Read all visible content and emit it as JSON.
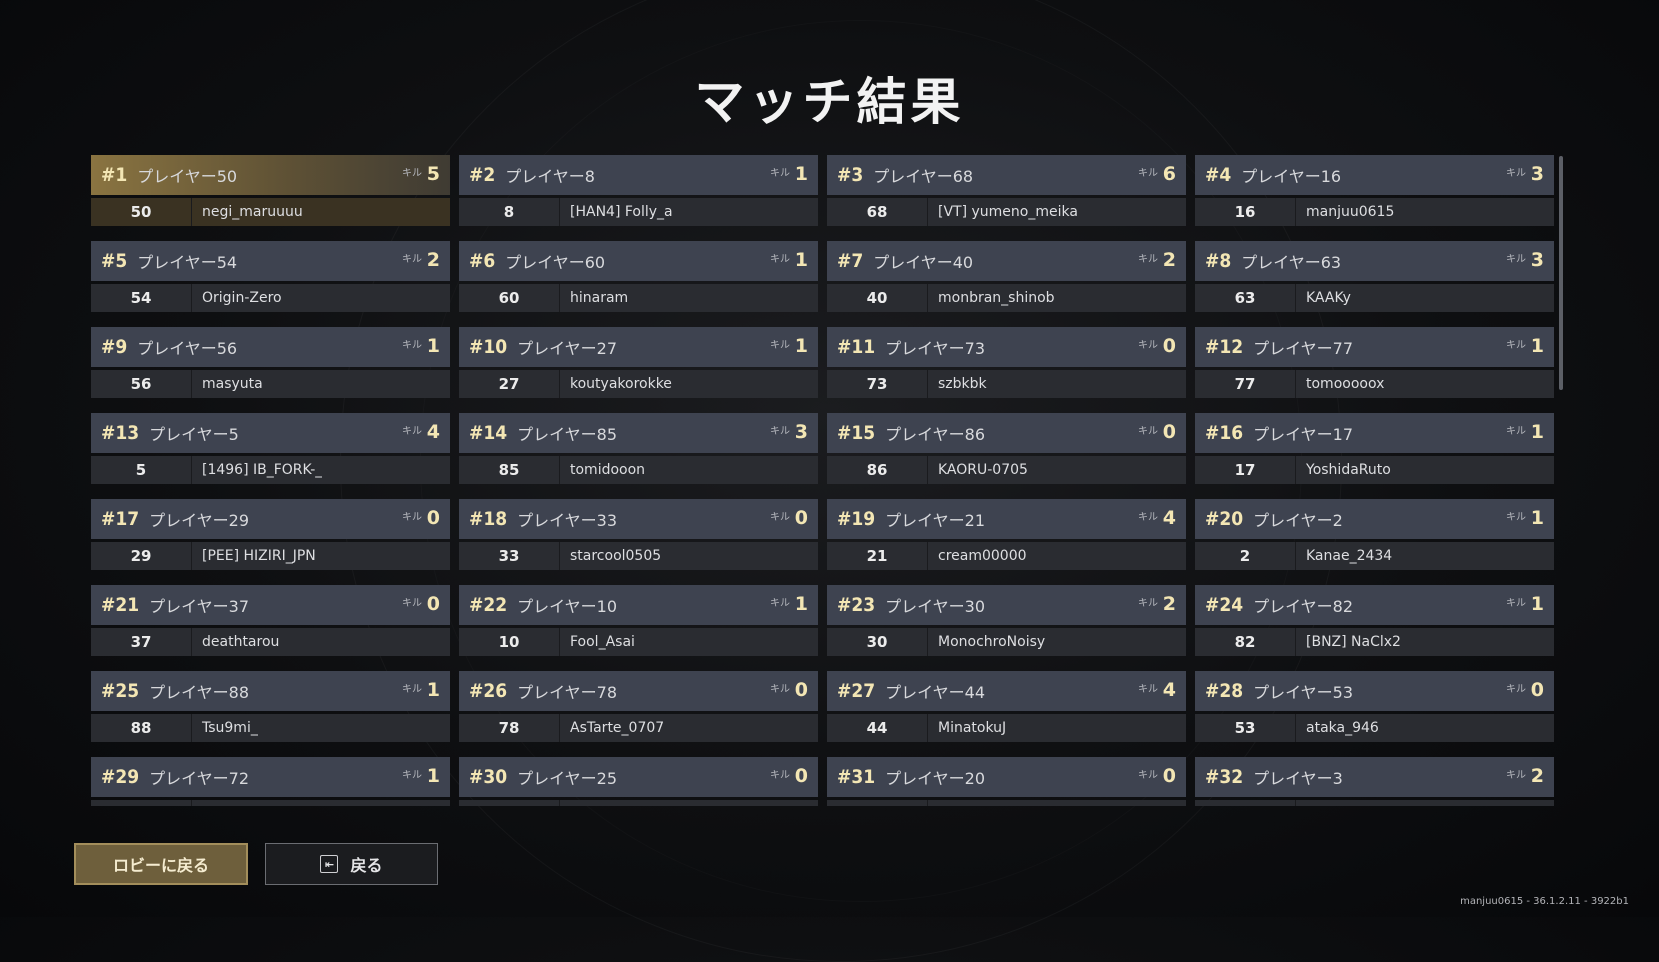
{
  "title": "マッチ結果",
  "kill_label": "キル",
  "results": [
    {
      "rank": "#1",
      "player": "プレイヤー50",
      "kills": "5",
      "num": "50",
      "user": "negi_maruuuu"
    },
    {
      "rank": "#2",
      "player": "プレイヤー8",
      "kills": "1",
      "num": "8",
      "user": "[HAN4] Folly_a"
    },
    {
      "rank": "#3",
      "player": "プレイヤー68",
      "kills": "6",
      "num": "68",
      "user": "[VT] yumeno_meika"
    },
    {
      "rank": "#4",
      "player": "プレイヤー16",
      "kills": "3",
      "num": "16",
      "user": "manjuu0615"
    },
    {
      "rank": "#5",
      "player": "プレイヤー54",
      "kills": "2",
      "num": "54",
      "user": "Origin-Zero"
    },
    {
      "rank": "#6",
      "player": "プレイヤー60",
      "kills": "1",
      "num": "60",
      "user": "hinaram"
    },
    {
      "rank": "#7",
      "player": "プレイヤー40",
      "kills": "2",
      "num": "40",
      "user": "monbran_shinob"
    },
    {
      "rank": "#8",
      "player": "プレイヤー63",
      "kills": "3",
      "num": "63",
      "user": "KAAKy"
    },
    {
      "rank": "#9",
      "player": "プレイヤー56",
      "kills": "1",
      "num": "56",
      "user": "masyuta"
    },
    {
      "rank": "#10",
      "player": "プレイヤー27",
      "kills": "1",
      "num": "27",
      "user": "koutyakorokke"
    },
    {
      "rank": "#11",
      "player": "プレイヤー73",
      "kills": "0",
      "num": "73",
      "user": "szbkbk"
    },
    {
      "rank": "#12",
      "player": "プレイヤー77",
      "kills": "1",
      "num": "77",
      "user": "tomooooox"
    },
    {
      "rank": "#13",
      "player": "プレイヤー5",
      "kills": "4",
      "num": "5",
      "user": "[1496] IB_FORK-_"
    },
    {
      "rank": "#14",
      "player": "プレイヤー85",
      "kills": "3",
      "num": "85",
      "user": "tomidooon"
    },
    {
      "rank": "#15",
      "player": "プレイヤー86",
      "kills": "0",
      "num": "86",
      "user": "KAORU-0705"
    },
    {
      "rank": "#16",
      "player": "プレイヤー17",
      "kills": "1",
      "num": "17",
      "user": "YoshidaRuto"
    },
    {
      "rank": "#17",
      "player": "プレイヤー29",
      "kills": "0",
      "num": "29",
      "user": "[PEE] HIZIRI_JPN"
    },
    {
      "rank": "#18",
      "player": "プレイヤー33",
      "kills": "0",
      "num": "33",
      "user": "starcool0505"
    },
    {
      "rank": "#19",
      "player": "プレイヤー21",
      "kills": "4",
      "num": "21",
      "user": "cream00000"
    },
    {
      "rank": "#20",
      "player": "プレイヤー2",
      "kills": "1",
      "num": "2",
      "user": "Kanae_2434"
    },
    {
      "rank": "#21",
      "player": "プレイヤー37",
      "kills": "0",
      "num": "37",
      "user": "deathtarou"
    },
    {
      "rank": "#22",
      "player": "プレイヤー10",
      "kills": "1",
      "num": "10",
      "user": "Fool_Asai"
    },
    {
      "rank": "#23",
      "player": "プレイヤー30",
      "kills": "2",
      "num": "30",
      "user": "MonochroNoisy"
    },
    {
      "rank": "#24",
      "player": "プレイヤー82",
      "kills": "1",
      "num": "82",
      "user": "[BNZ] NaClx2"
    },
    {
      "rank": "#25",
      "player": "プレイヤー88",
      "kills": "1",
      "num": "88",
      "user": "Tsu9mi_"
    },
    {
      "rank": "#26",
      "player": "プレイヤー78",
      "kills": "0",
      "num": "78",
      "user": "AsTarte_0707"
    },
    {
      "rank": "#27",
      "player": "プレイヤー44",
      "kills": "4",
      "num": "44",
      "user": "MinatokuJ"
    },
    {
      "rank": "#28",
      "player": "プレイヤー53",
      "kills": "0",
      "num": "53",
      "user": "ataka_946"
    },
    {
      "rank": "#29",
      "player": "プレイヤー72",
      "kills": "1",
      "num": "",
      "user": ""
    },
    {
      "rank": "#30",
      "player": "プレイヤー25",
      "kills": "0",
      "num": "",
      "user": ""
    },
    {
      "rank": "#31",
      "player": "プレイヤー20",
      "kills": "0",
      "num": "",
      "user": ""
    },
    {
      "rank": "#32",
      "player": "プレイヤー3",
      "kills": "2",
      "num": "",
      "user": ""
    }
  ],
  "buttons": {
    "lobby_label": "ロビーに戻る",
    "back_label": "戻る",
    "back_icon": "back-arrow-icon"
  },
  "footer": "manjuu0615 - 36.1.2.11 - 3922b1",
  "colors": {
    "accent_gold": "#f3e6b4",
    "card_bg": "#3e4350",
    "first_place_bg": "#8a7441",
    "lobby_button_bg": "#6e5f3c"
  }
}
